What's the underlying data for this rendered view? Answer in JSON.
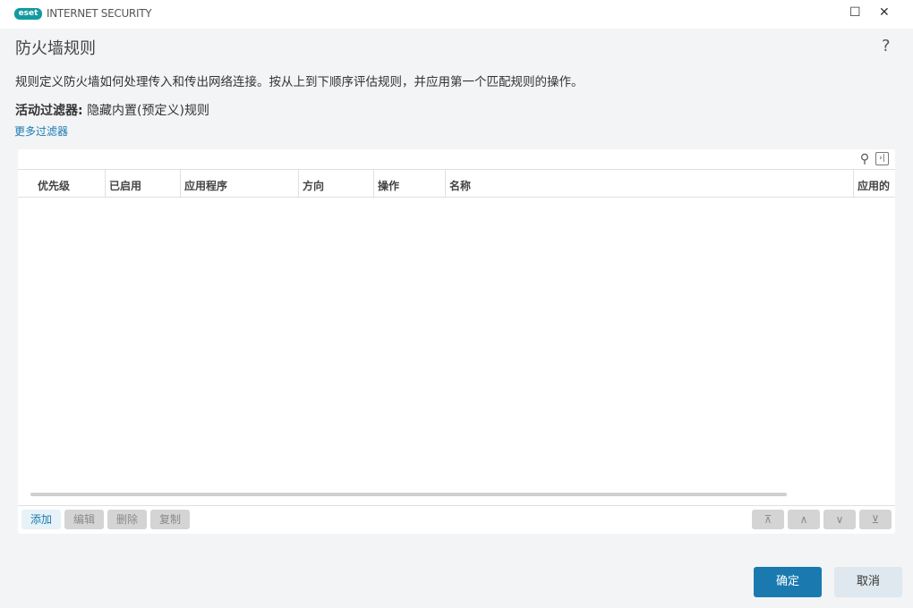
{
  "window": {
    "logo": "eset",
    "app_name": "INTERNET SECURITY"
  },
  "page": {
    "title": "防火墙规则",
    "help": "?",
    "description": "规则定义防火墙如何处理传入和传出网络连接。按从上到下顺序评估规则，并应用第一个匹配规则的操作。",
    "filter_label": "活动过滤器:",
    "filter_value": "隐藏内置(预定义)规则",
    "more_filters": "更多过滤器"
  },
  "table": {
    "columns": [
      "优先级",
      "已启用",
      "应用程序",
      "方向",
      "操作",
      "名称",
      "应用的"
    ],
    "rows": []
  },
  "buttons": {
    "add": "添加",
    "edit": "编辑",
    "delete": "删除",
    "copy": "复制",
    "ok": "确定",
    "cancel": "取消"
  },
  "colors": {
    "accent": "#1a7ab0",
    "logo": "#139aa0"
  }
}
